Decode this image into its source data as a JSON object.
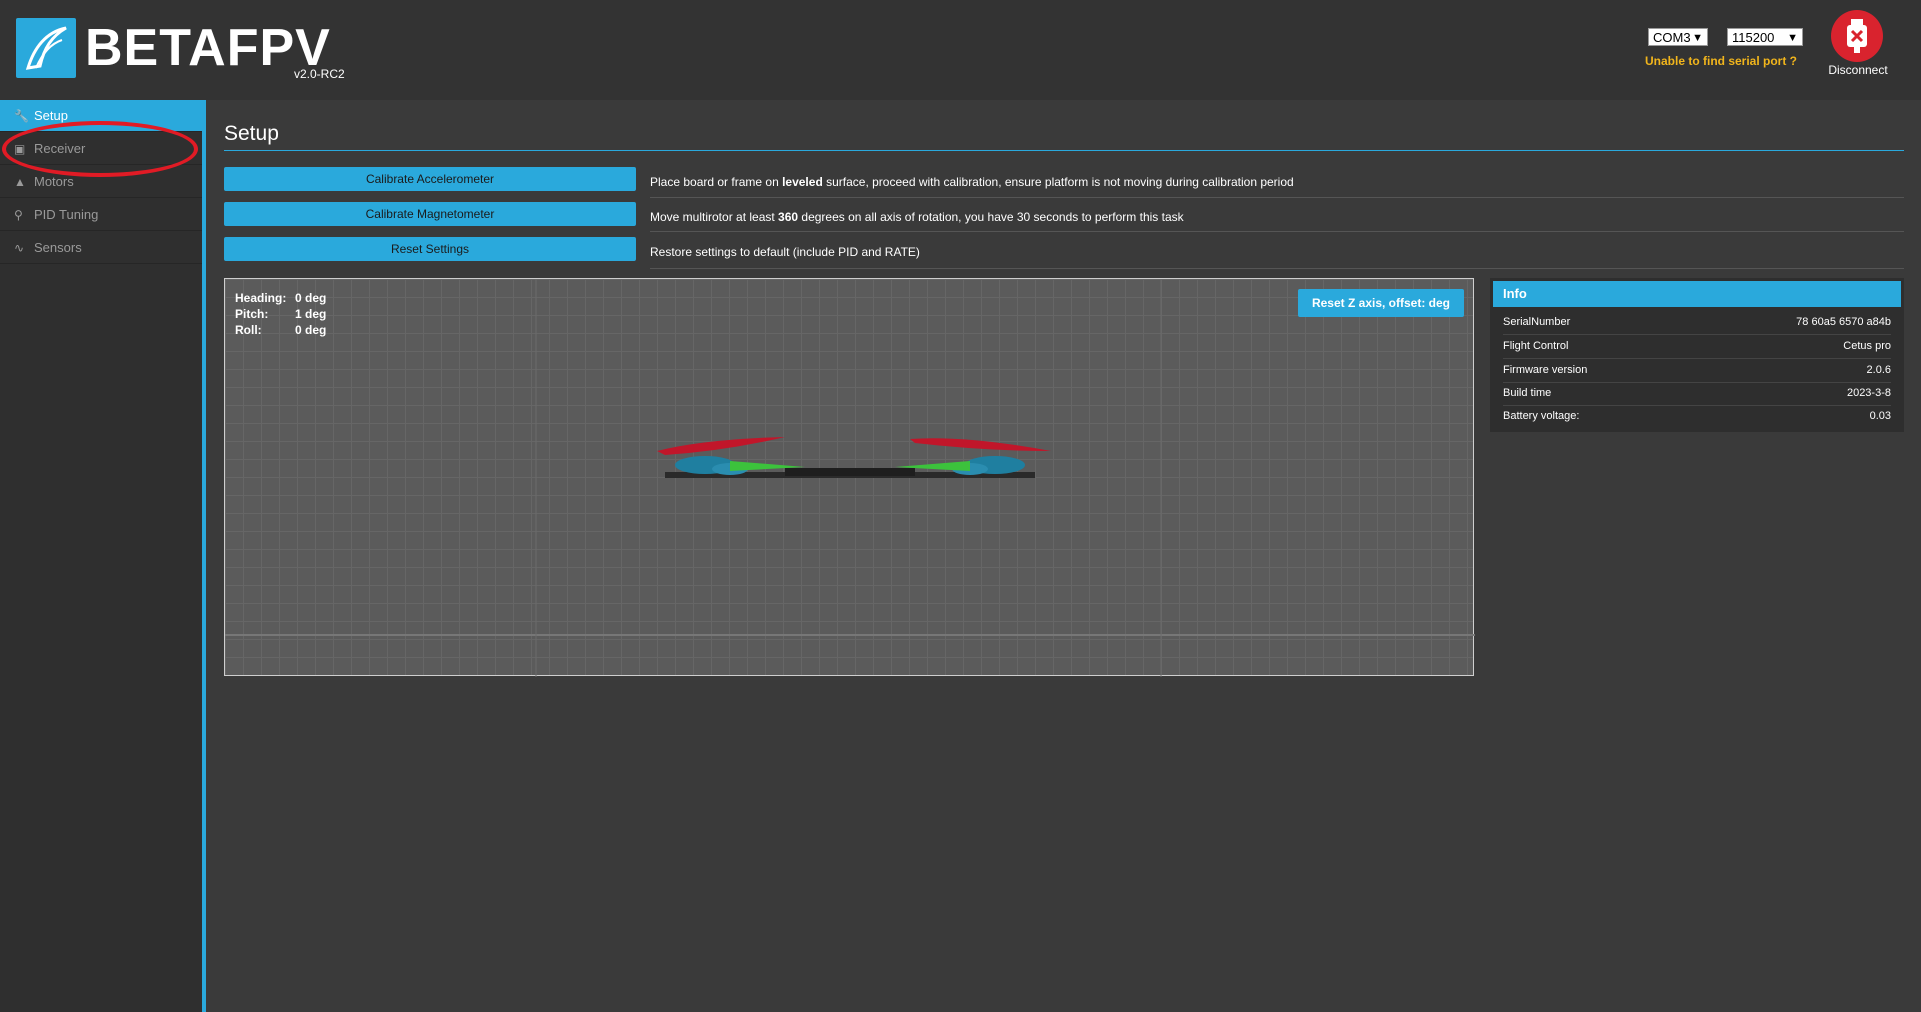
{
  "header": {
    "brand": "BETAFPV",
    "version": "v2.0-RC2",
    "port": "COM3",
    "baud": "115200",
    "serial_warning": "Unable to find serial port ?",
    "disconnect_label": "Disconnect"
  },
  "sidebar": {
    "items": [
      {
        "label": "Setup",
        "icon": "wrench-icon"
      },
      {
        "label": "Receiver",
        "icon": "receiver-icon"
      },
      {
        "label": "Motors",
        "icon": "motor-icon"
      },
      {
        "label": "PID Tuning",
        "icon": "pid-icon"
      },
      {
        "label": "Sensors",
        "icon": "sensor-icon"
      }
    ]
  },
  "main": {
    "title": "Setup",
    "actions": [
      {
        "button": "Calibrate Accelerometer",
        "description_pre": "Place board or frame on ",
        "description_bold": "leveled",
        "description_post": " surface, proceed with calibration, ensure platform is not moving during calibration period"
      },
      {
        "button": "Calibrate Magnetometer",
        "description_pre": "Move multirotor at least ",
        "description_bold": "360",
        "description_post": " degrees on all axis of rotation, you have 30 seconds to perform this task"
      },
      {
        "button": "Reset Settings",
        "description_pre": "Restore settings to default  (include PID and RATE)",
        "description_bold": "",
        "description_post": ""
      }
    ],
    "attitude": {
      "heading_label": "Heading:",
      "heading_value": "0 deg",
      "pitch_label": "Pitch:",
      "pitch_value": "1 deg",
      "roll_label": "Roll:",
      "roll_value": "0 deg"
    },
    "reset_z_label": "Reset Z axis, offset: deg"
  },
  "info": {
    "title": "Info",
    "rows": [
      {
        "label": "SerialNumber",
        "value": "78 60a5 6570 a84b"
      },
      {
        "label": "Flight Control",
        "value": "Cetus pro"
      },
      {
        "label": "Firmware version",
        "value": "2.0.6"
      },
      {
        "label": "Build time",
        "value": "2023-3-8"
      },
      {
        "label": "Battery voltage:",
        "value": "0.03"
      }
    ]
  },
  "colors": {
    "accent": "#2aa9dc",
    "warning": "#f1b51c",
    "disconnect": "#d9232e",
    "annotation": "#e11b25"
  }
}
